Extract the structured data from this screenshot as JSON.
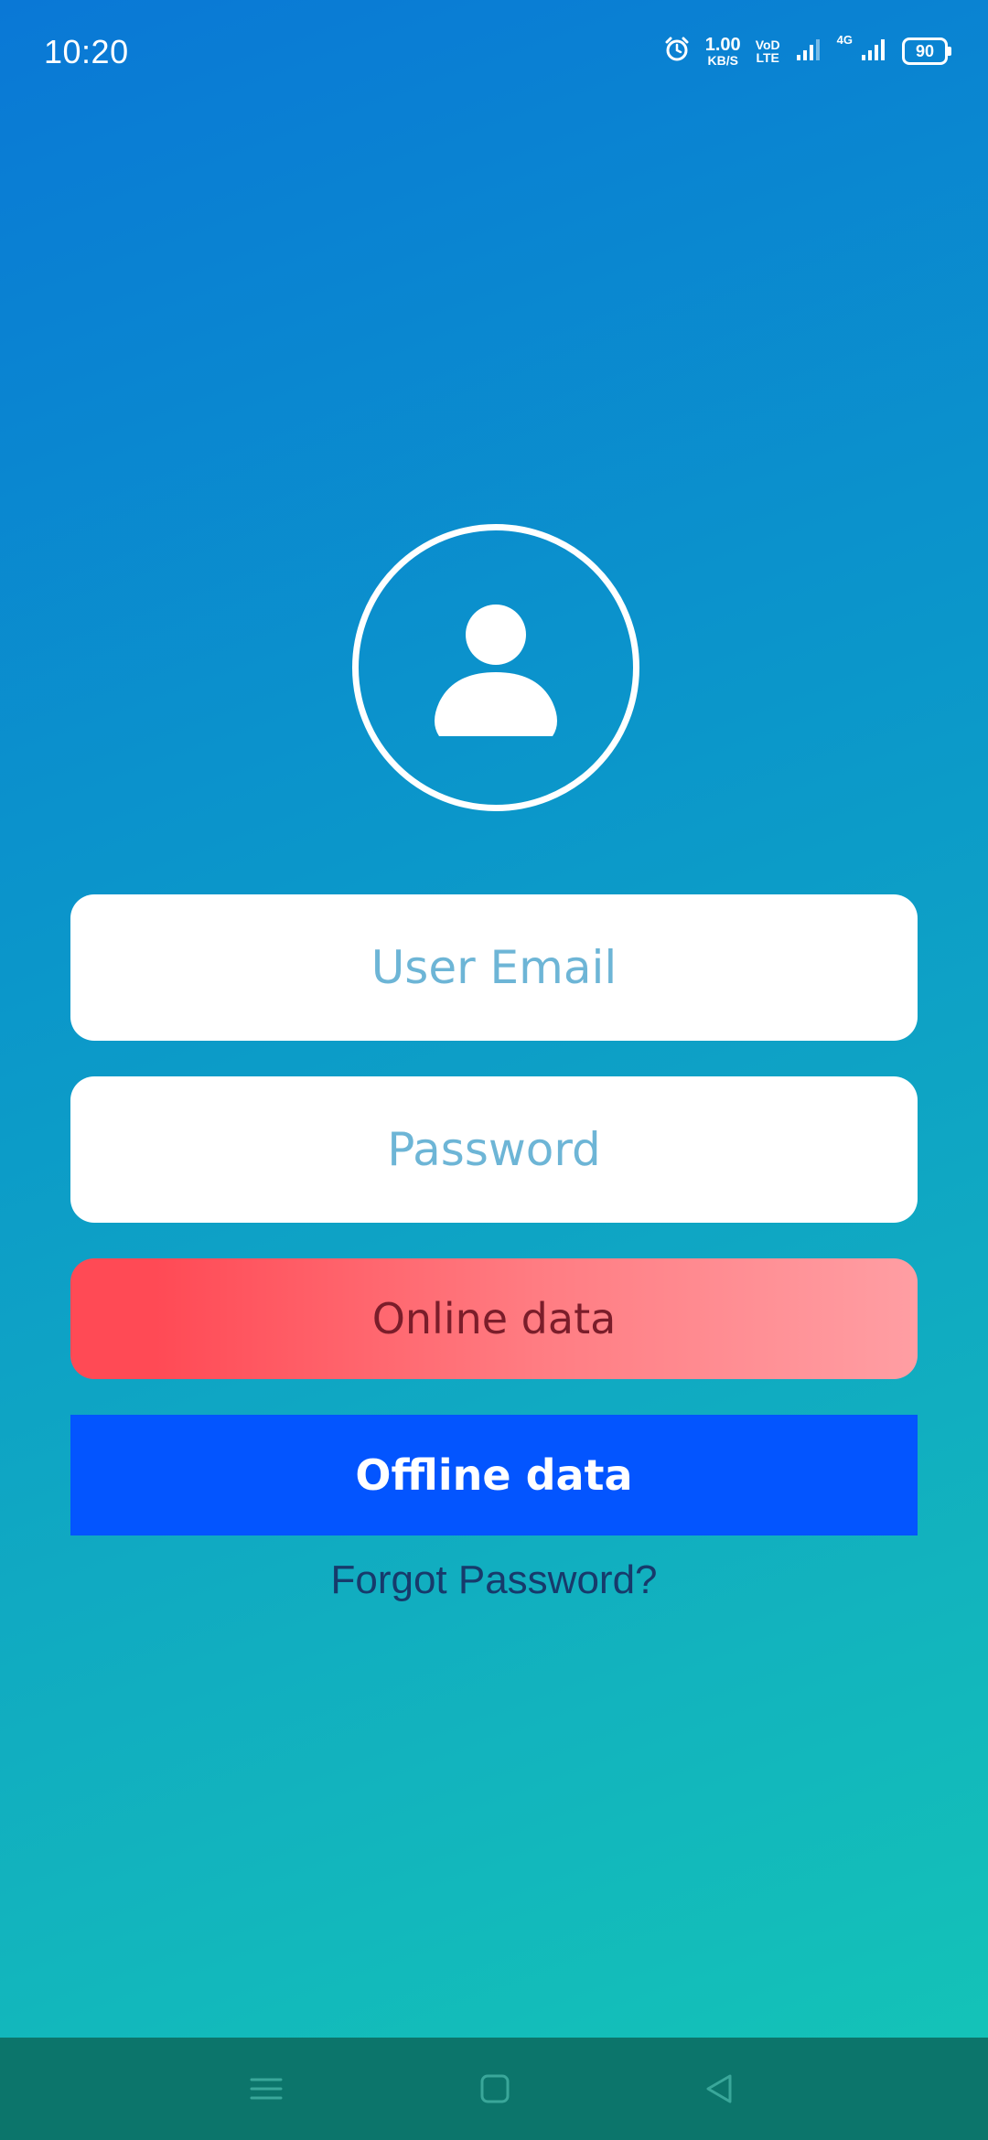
{
  "status_bar": {
    "time": "10:20",
    "net_speed_value": "1.00",
    "net_speed_unit": "KB/S",
    "volte_top": "VoD",
    "volte_bottom": "LTE",
    "sim2_label": "4G",
    "battery_level": "90",
    "icons": [
      "alarm-icon",
      "signal-icon",
      "signal-icon-sim2",
      "battery-icon"
    ]
  },
  "login": {
    "avatar_icon": "user-avatar-icon",
    "email_placeholder": "User Email",
    "email_value": "",
    "password_placeholder": "Password",
    "password_value": "",
    "online_button_label": "Online data",
    "offline_button_label": "Offline data",
    "forgot_password_label": "Forgot Password?"
  },
  "navigation": {
    "icons": [
      "menu-icon",
      "home-icon",
      "back-icon"
    ]
  },
  "colors": {
    "background_top": "#0a78d6",
    "background_bottom": "#14c6b6",
    "online_button_start": "#ff4a55",
    "online_button_end": "#ff9ea3",
    "offline_button": "#0355ff",
    "placeholder_text": "#6db5d6",
    "nav_bar": "#0c756b"
  }
}
